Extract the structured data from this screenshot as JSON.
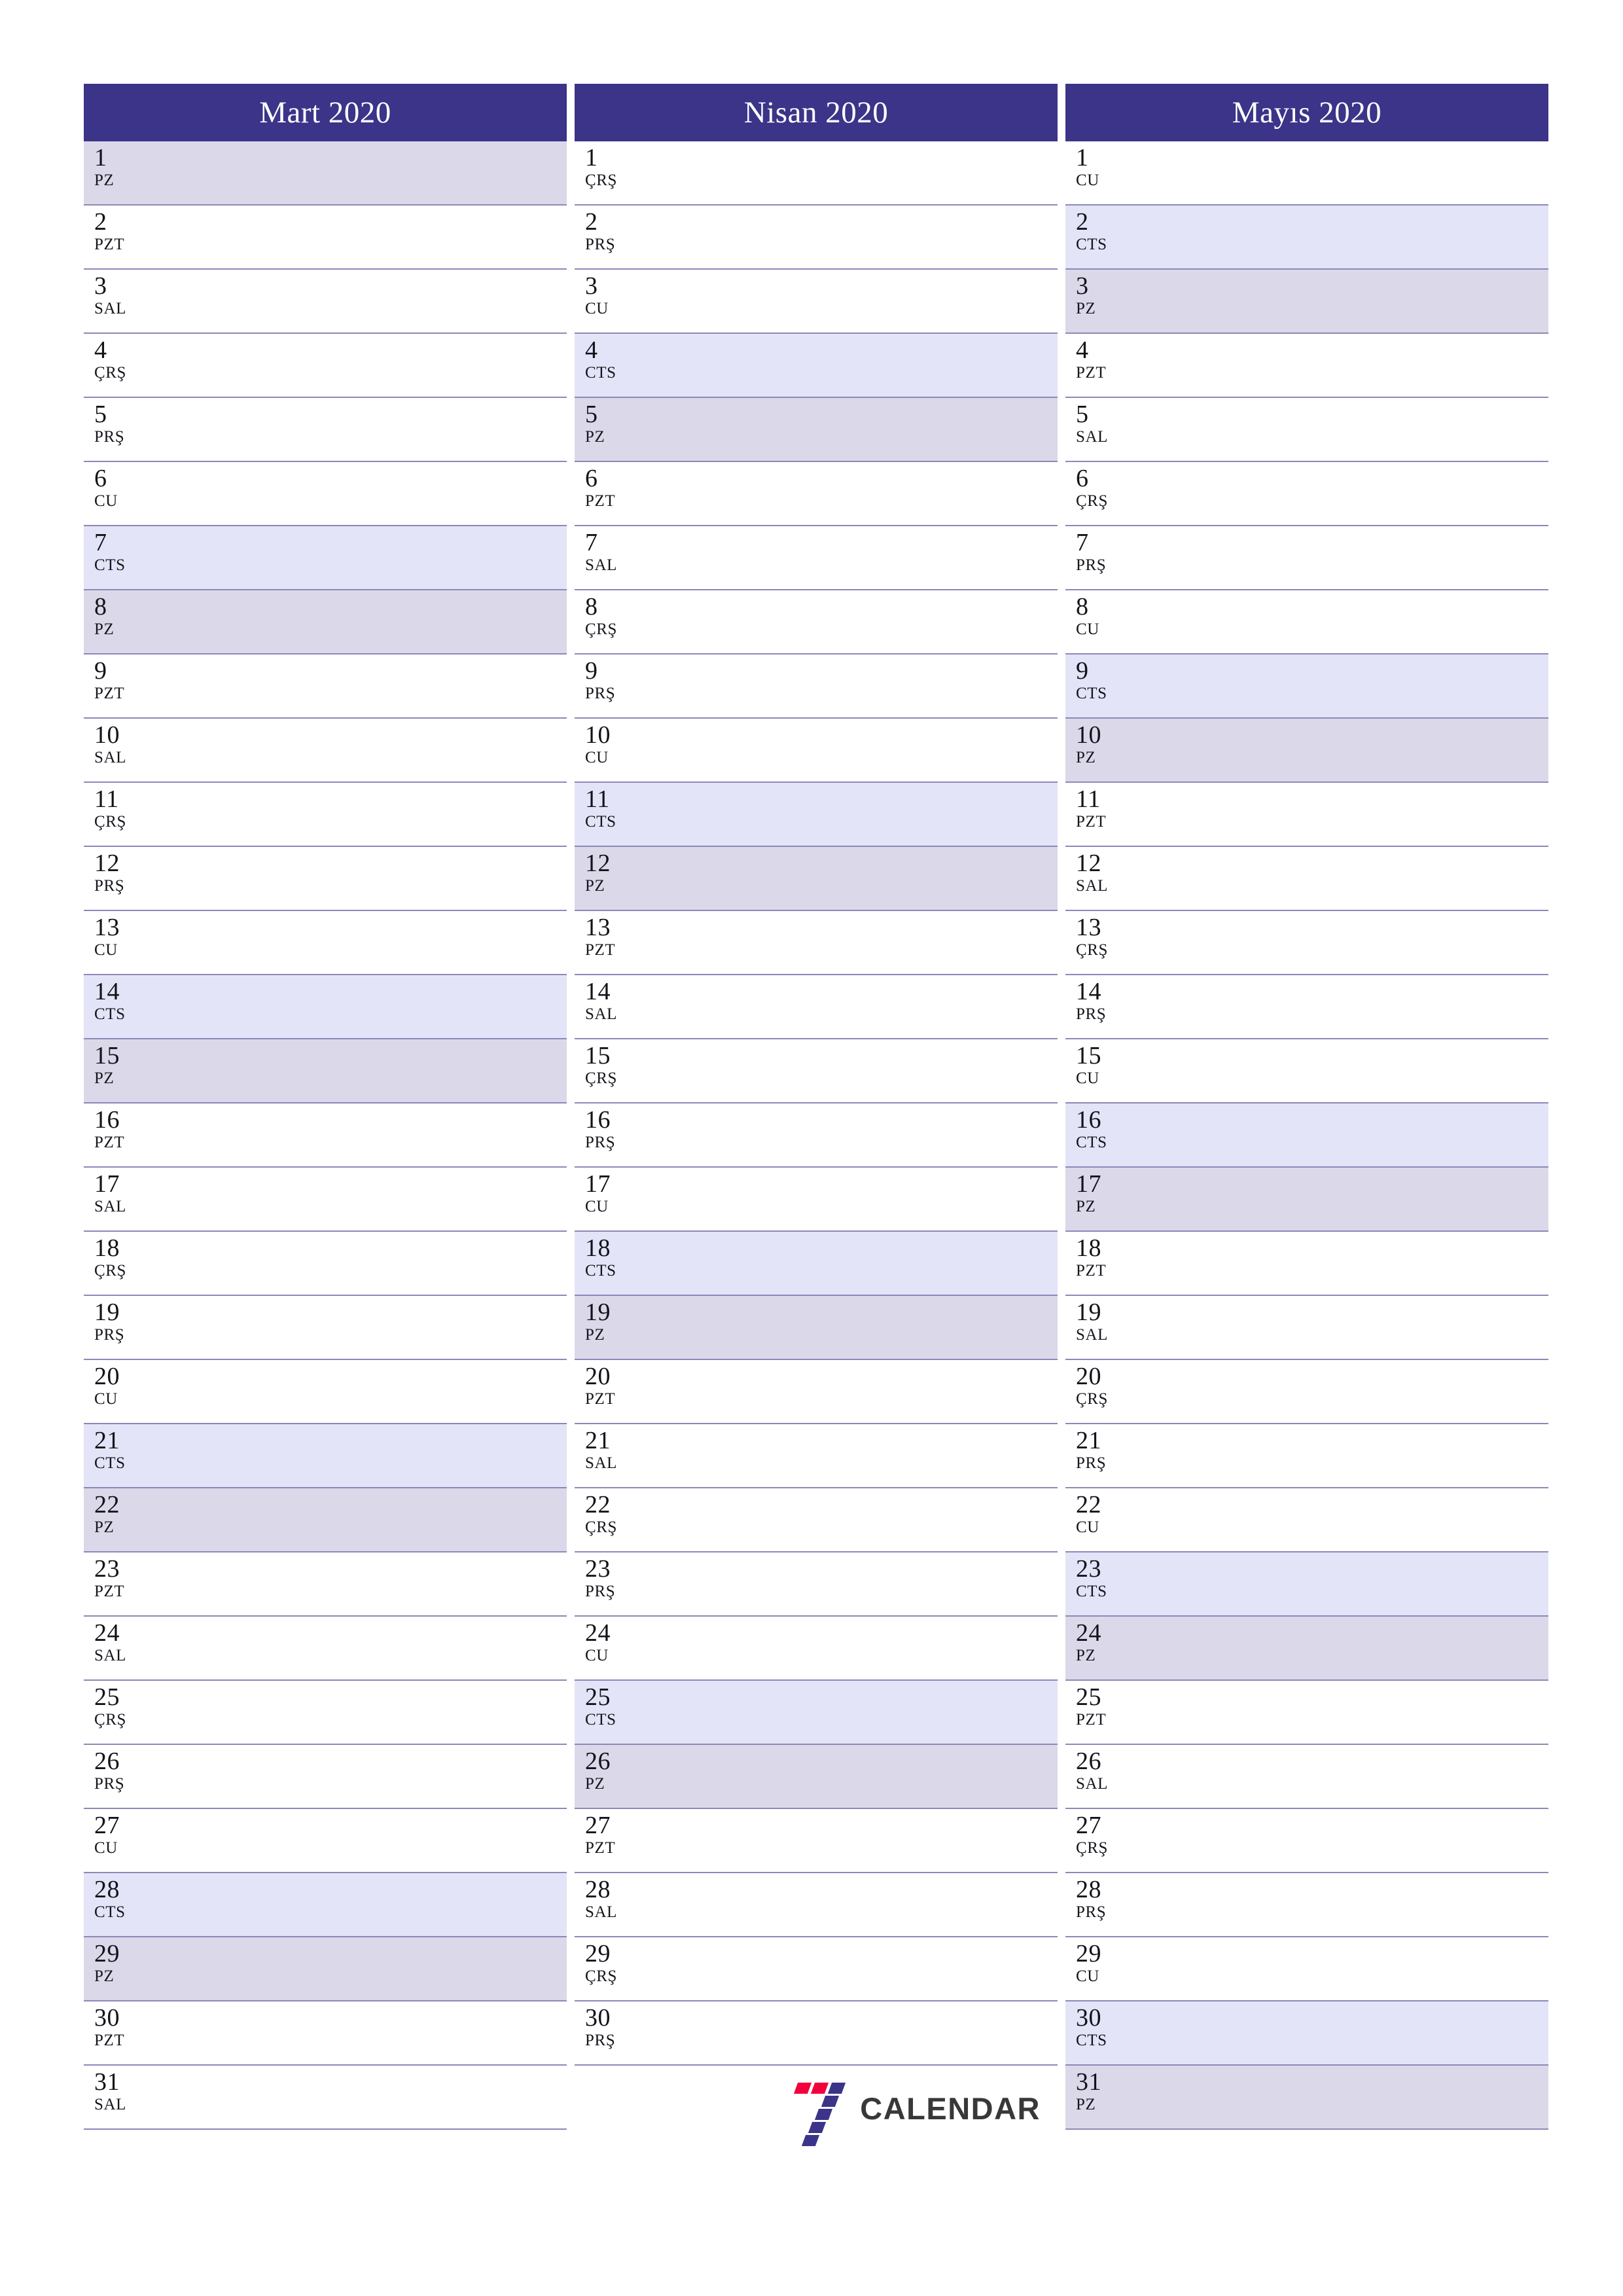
{
  "colors": {
    "header_bg": "#3b3489",
    "header_text": "#ffffff",
    "saturday_bg": "#e4e4f8",
    "sunday_bg": "#dbd8ea",
    "row_border": "#8c88b9",
    "logo_red": "#f4003c",
    "logo_indigo": "#3b3489",
    "logo_text": "#383838"
  },
  "brand": {
    "mark": "seven-logo",
    "text": "CALENDAR"
  },
  "months": [
    {
      "title": "Mart 2020",
      "days": [
        {
          "num": "1",
          "weekday": "PZ",
          "type": "sun"
        },
        {
          "num": "2",
          "weekday": "PZT",
          "type": "weekday"
        },
        {
          "num": "3",
          "weekday": "SAL",
          "type": "weekday"
        },
        {
          "num": "4",
          "weekday": "ÇRŞ",
          "type": "weekday"
        },
        {
          "num": "5",
          "weekday": "PRŞ",
          "type": "weekday"
        },
        {
          "num": "6",
          "weekday": "CU",
          "type": "weekday"
        },
        {
          "num": "7",
          "weekday": "CTS",
          "type": "sat"
        },
        {
          "num": "8",
          "weekday": "PZ",
          "type": "sun"
        },
        {
          "num": "9",
          "weekday": "PZT",
          "type": "weekday"
        },
        {
          "num": "10",
          "weekday": "SAL",
          "type": "weekday"
        },
        {
          "num": "11",
          "weekday": "ÇRŞ",
          "type": "weekday"
        },
        {
          "num": "12",
          "weekday": "PRŞ",
          "type": "weekday"
        },
        {
          "num": "13",
          "weekday": "CU",
          "type": "weekday"
        },
        {
          "num": "14",
          "weekday": "CTS",
          "type": "sat"
        },
        {
          "num": "15",
          "weekday": "PZ",
          "type": "sun"
        },
        {
          "num": "16",
          "weekday": "PZT",
          "type": "weekday"
        },
        {
          "num": "17",
          "weekday": "SAL",
          "type": "weekday"
        },
        {
          "num": "18",
          "weekday": "ÇRŞ",
          "type": "weekday"
        },
        {
          "num": "19",
          "weekday": "PRŞ",
          "type": "weekday"
        },
        {
          "num": "20",
          "weekday": "CU",
          "type": "weekday"
        },
        {
          "num": "21",
          "weekday": "CTS",
          "type": "sat"
        },
        {
          "num": "22",
          "weekday": "PZ",
          "type": "sun"
        },
        {
          "num": "23",
          "weekday": "PZT",
          "type": "weekday"
        },
        {
          "num": "24",
          "weekday": "SAL",
          "type": "weekday"
        },
        {
          "num": "25",
          "weekday": "ÇRŞ",
          "type": "weekday"
        },
        {
          "num": "26",
          "weekday": "PRŞ",
          "type": "weekday"
        },
        {
          "num": "27",
          "weekday": "CU",
          "type": "weekday"
        },
        {
          "num": "28",
          "weekday": "CTS",
          "type": "sat"
        },
        {
          "num": "29",
          "weekday": "PZ",
          "type": "sun"
        },
        {
          "num": "30",
          "weekday": "PZT",
          "type": "weekday"
        },
        {
          "num": "31",
          "weekday": "SAL",
          "type": "weekday"
        }
      ]
    },
    {
      "title": "Nisan 2020",
      "days": [
        {
          "num": "1",
          "weekday": "ÇRŞ",
          "type": "weekday"
        },
        {
          "num": "2",
          "weekday": "PRŞ",
          "type": "weekday"
        },
        {
          "num": "3",
          "weekday": "CU",
          "type": "weekday"
        },
        {
          "num": "4",
          "weekday": "CTS",
          "type": "sat"
        },
        {
          "num": "5",
          "weekday": "PZ",
          "type": "sun"
        },
        {
          "num": "6",
          "weekday": "PZT",
          "type": "weekday"
        },
        {
          "num": "7",
          "weekday": "SAL",
          "type": "weekday"
        },
        {
          "num": "8",
          "weekday": "ÇRŞ",
          "type": "weekday"
        },
        {
          "num": "9",
          "weekday": "PRŞ",
          "type": "weekday"
        },
        {
          "num": "10",
          "weekday": "CU",
          "type": "weekday"
        },
        {
          "num": "11",
          "weekday": "CTS",
          "type": "sat"
        },
        {
          "num": "12",
          "weekday": "PZ",
          "type": "sun"
        },
        {
          "num": "13",
          "weekday": "PZT",
          "type": "weekday"
        },
        {
          "num": "14",
          "weekday": "SAL",
          "type": "weekday"
        },
        {
          "num": "15",
          "weekday": "ÇRŞ",
          "type": "weekday"
        },
        {
          "num": "16",
          "weekday": "PRŞ",
          "type": "weekday"
        },
        {
          "num": "17",
          "weekday": "CU",
          "type": "weekday"
        },
        {
          "num": "18",
          "weekday": "CTS",
          "type": "sat"
        },
        {
          "num": "19",
          "weekday": "PZ",
          "type": "sun"
        },
        {
          "num": "20",
          "weekday": "PZT",
          "type": "weekday"
        },
        {
          "num": "21",
          "weekday": "SAL",
          "type": "weekday"
        },
        {
          "num": "22",
          "weekday": "ÇRŞ",
          "type": "weekday"
        },
        {
          "num": "23",
          "weekday": "PRŞ",
          "type": "weekday"
        },
        {
          "num": "24",
          "weekday": "CU",
          "type": "weekday"
        },
        {
          "num": "25",
          "weekday": "CTS",
          "type": "sat"
        },
        {
          "num": "26",
          "weekday": "PZ",
          "type": "sun"
        },
        {
          "num": "27",
          "weekday": "PZT",
          "type": "weekday"
        },
        {
          "num": "28",
          "weekday": "SAL",
          "type": "weekday"
        },
        {
          "num": "29",
          "weekday": "ÇRŞ",
          "type": "weekday"
        },
        {
          "num": "30",
          "weekday": "PRŞ",
          "type": "weekday"
        }
      ]
    },
    {
      "title": "Mayıs 2020",
      "days": [
        {
          "num": "1",
          "weekday": "CU",
          "type": "weekday"
        },
        {
          "num": "2",
          "weekday": "CTS",
          "type": "sat"
        },
        {
          "num": "3",
          "weekday": "PZ",
          "type": "sun"
        },
        {
          "num": "4",
          "weekday": "PZT",
          "type": "weekday"
        },
        {
          "num": "5",
          "weekday": "SAL",
          "type": "weekday"
        },
        {
          "num": "6",
          "weekday": "ÇRŞ",
          "type": "weekday"
        },
        {
          "num": "7",
          "weekday": "PRŞ",
          "type": "weekday"
        },
        {
          "num": "8",
          "weekday": "CU",
          "type": "weekday"
        },
        {
          "num": "9",
          "weekday": "CTS",
          "type": "sat"
        },
        {
          "num": "10",
          "weekday": "PZ",
          "type": "sun"
        },
        {
          "num": "11",
          "weekday": "PZT",
          "type": "weekday"
        },
        {
          "num": "12",
          "weekday": "SAL",
          "type": "weekday"
        },
        {
          "num": "13",
          "weekday": "ÇRŞ",
          "type": "weekday"
        },
        {
          "num": "14",
          "weekday": "PRŞ",
          "type": "weekday"
        },
        {
          "num": "15",
          "weekday": "CU",
          "type": "weekday"
        },
        {
          "num": "16",
          "weekday": "CTS",
          "type": "sat"
        },
        {
          "num": "17",
          "weekday": "PZ",
          "type": "sun"
        },
        {
          "num": "18",
          "weekday": "PZT",
          "type": "weekday"
        },
        {
          "num": "19",
          "weekday": "SAL",
          "type": "weekday"
        },
        {
          "num": "20",
          "weekday": "ÇRŞ",
          "type": "weekday"
        },
        {
          "num": "21",
          "weekday": "PRŞ",
          "type": "weekday"
        },
        {
          "num": "22",
          "weekday": "CU",
          "type": "weekday"
        },
        {
          "num": "23",
          "weekday": "CTS",
          "type": "sat"
        },
        {
          "num": "24",
          "weekday": "PZ",
          "type": "sun"
        },
        {
          "num": "25",
          "weekday": "PZT",
          "type": "weekday"
        },
        {
          "num": "26",
          "weekday": "SAL",
          "type": "weekday"
        },
        {
          "num": "27",
          "weekday": "ÇRŞ",
          "type": "weekday"
        },
        {
          "num": "28",
          "weekday": "PRŞ",
          "type": "weekday"
        },
        {
          "num": "29",
          "weekday": "CU",
          "type": "weekday"
        },
        {
          "num": "30",
          "weekday": "CTS",
          "type": "sat"
        },
        {
          "num": "31",
          "weekday": "PZ",
          "type": "sun"
        }
      ]
    }
  ]
}
